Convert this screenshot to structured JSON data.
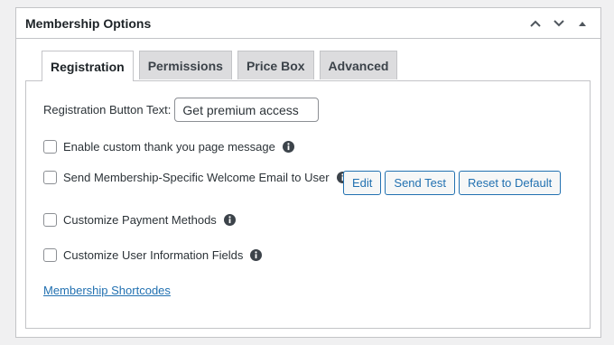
{
  "panel": {
    "title": "Membership Options",
    "actions": [
      "chevron-up-icon",
      "chevron-down-icon",
      "caret-up-icon"
    ]
  },
  "tabs": [
    {
      "label": "Registration",
      "active": true
    },
    {
      "label": "Permissions",
      "active": false
    },
    {
      "label": "Price Box",
      "active": false
    },
    {
      "label": "Advanced",
      "active": false
    }
  ],
  "registration": {
    "button_text_label": "Registration Button Text:",
    "button_text_value": "Get premium access",
    "options": [
      {
        "label": "Enable custom thank you page message",
        "checked": false
      },
      {
        "label": "Send Membership-Specific Welcome Email to User",
        "checked": false
      },
      {
        "label": "Customize Payment Methods",
        "checked": false
      },
      {
        "label": "Customize User Information Fields",
        "checked": false
      }
    ],
    "email_buttons": {
      "edit": "Edit",
      "send_test": "Send Test",
      "reset": "Reset to Default"
    },
    "shortcodes_link": "Membership Shortcodes"
  },
  "colors": {
    "accent": "#2271b1",
    "border": "#c3c4c7",
    "background": "#f0f0f1"
  }
}
